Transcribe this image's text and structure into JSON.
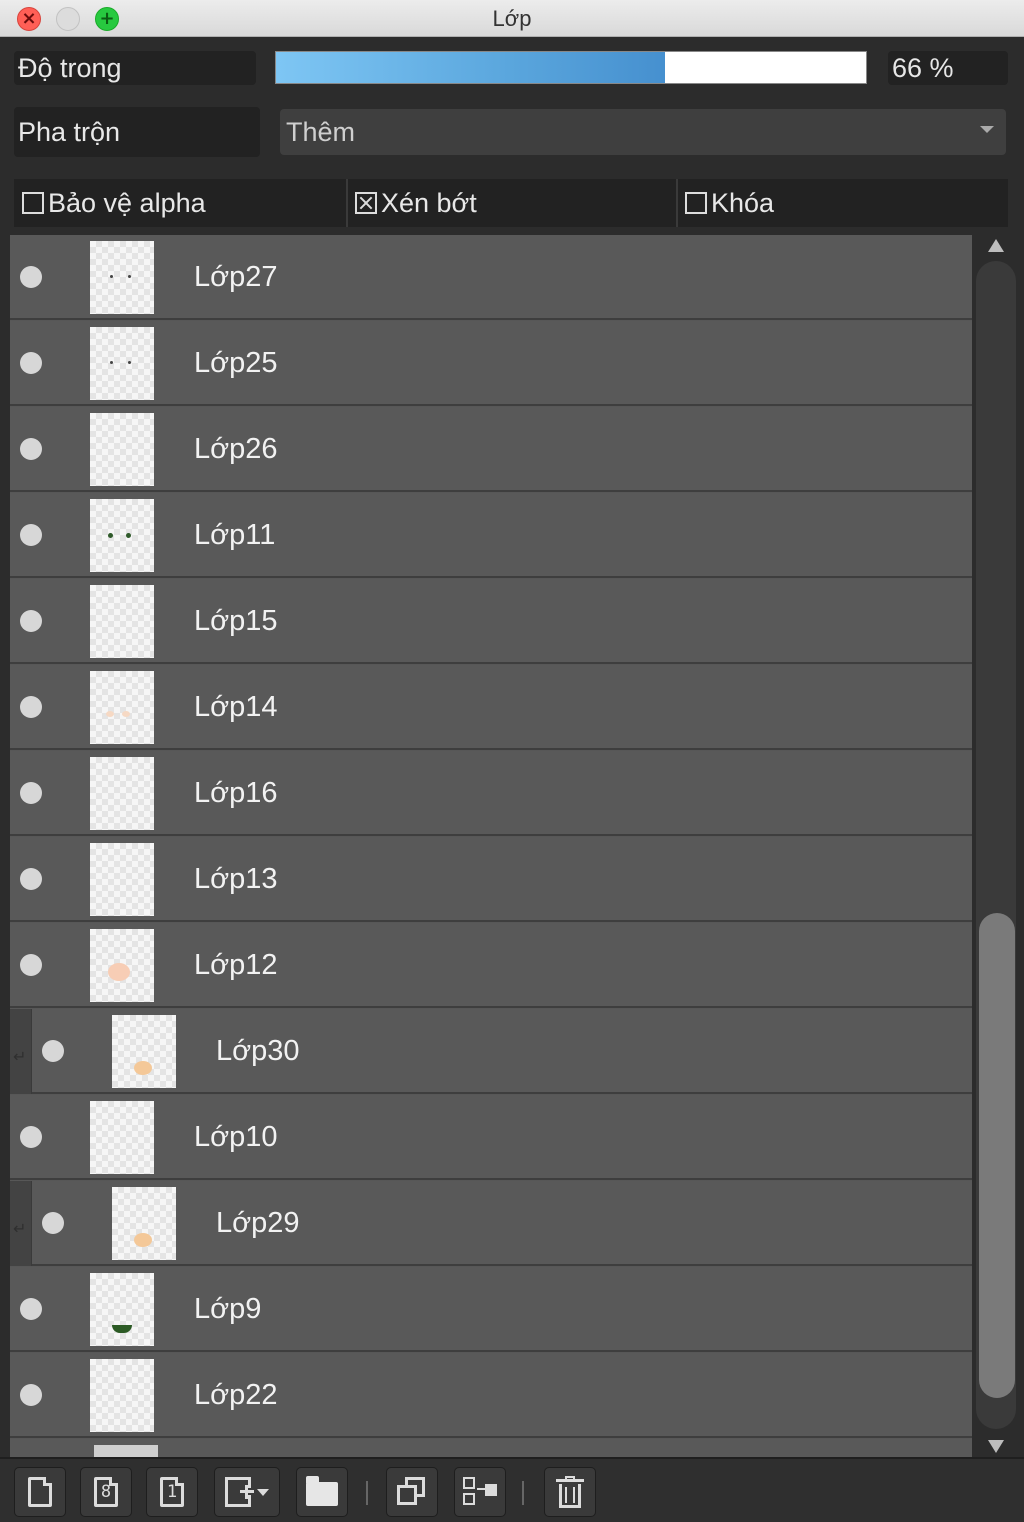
{
  "window": {
    "title": "Lớp"
  },
  "opacity": {
    "label": "Độ trong",
    "value_text": "66 %",
    "value": 66
  },
  "blend": {
    "label": "Pha trộn",
    "selected": "Thêm"
  },
  "options": {
    "alpha_protect": {
      "label": "Bảo vệ alpha",
      "checked": false
    },
    "clipping": {
      "label": "Xén bớt",
      "checked": true
    },
    "lock": {
      "label": "Khóa",
      "checked": false
    }
  },
  "layers": [
    {
      "name": "Lớp27",
      "clipped": false,
      "thumb": "dots-dark-small"
    },
    {
      "name": "Lớp25",
      "clipped": false,
      "thumb": "dots-dark-small"
    },
    {
      "name": "Lớp26",
      "clipped": false,
      "thumb": "empty"
    },
    {
      "name": "Lớp11",
      "clipped": false,
      "thumb": "dots-green"
    },
    {
      "name": "Lớp15",
      "clipped": false,
      "thumb": "empty"
    },
    {
      "name": "Lớp14",
      "clipped": false,
      "thumb": "dots-peach"
    },
    {
      "name": "Lớp16",
      "clipped": false,
      "thumb": "empty"
    },
    {
      "name": "Lớp13",
      "clipped": false,
      "thumb": "empty"
    },
    {
      "name": "Lớp12",
      "clipped": false,
      "thumb": "blob-peach"
    },
    {
      "name": "Lớp30",
      "clipped": true,
      "thumb": "blob-orange"
    },
    {
      "name": "Lớp10",
      "clipped": false,
      "thumb": "empty"
    },
    {
      "name": "Lớp29",
      "clipped": true,
      "thumb": "blob-orange"
    },
    {
      "name": "Lớp9",
      "clipped": false,
      "thumb": "smile-green"
    },
    {
      "name": "Lớp22",
      "clipped": false,
      "thumb": "empty"
    }
  ],
  "toolbar": {
    "buttons": [
      {
        "icon": "new-layer-icon"
      },
      {
        "icon": "new-8bit-layer-icon",
        "glyph": "8"
      },
      {
        "icon": "new-1bit-layer-icon",
        "glyph": "1"
      },
      {
        "icon": "add-layer-menu-icon"
      },
      {
        "icon": "folder-icon"
      },
      {
        "icon": "duplicate-layer-icon"
      },
      {
        "icon": "merge-down-icon"
      },
      {
        "icon": "trash-icon"
      }
    ]
  },
  "colors": {
    "opacity_fill": "#5aa6dd",
    "layer_row": "#595959",
    "panel_bg": "#2c2c2c"
  }
}
